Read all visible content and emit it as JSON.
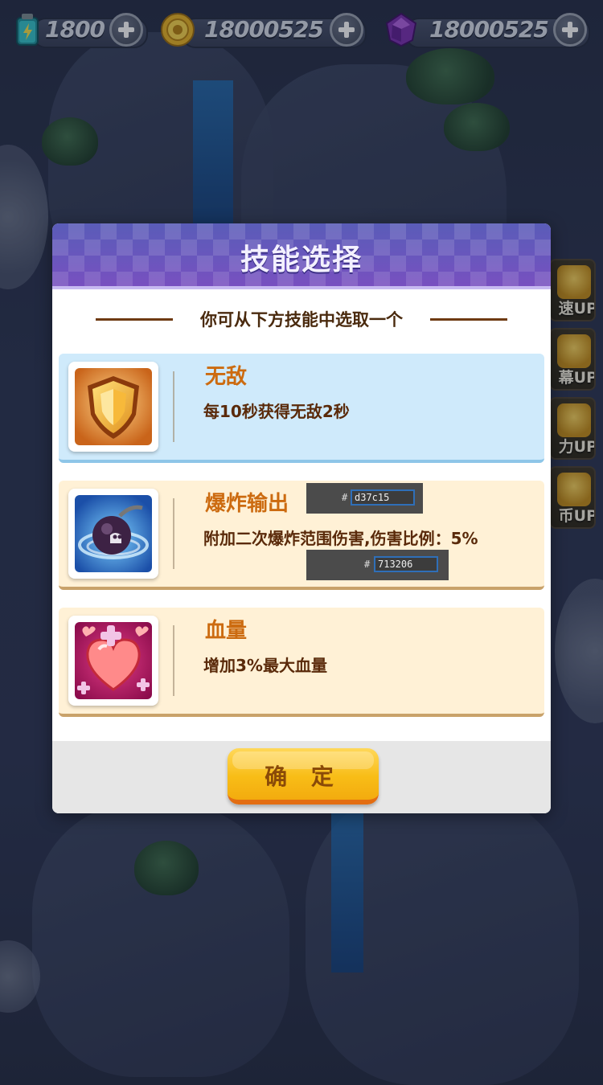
{
  "resources": {
    "energy": {
      "value": "1800",
      "icon": "battery-icon"
    },
    "coins": {
      "value": "18000525",
      "icon": "coin-icon"
    },
    "gems": {
      "value": "18000525",
      "icon": "gem-icon"
    }
  },
  "side_upgrades": [
    {
      "label": "速UP"
    },
    {
      "label": "幕UP"
    },
    {
      "label": "力UP"
    },
    {
      "label": "币UP"
    }
  ],
  "dialog": {
    "title": "技能选择",
    "subtitle": "你可从下方技能中选取一个",
    "skills": [
      {
        "name": "无敌",
        "description": "每10秒获得无敌2秒",
        "icon": "shield-icon"
      },
      {
        "name": "爆炸输出",
        "description": "附加二次爆炸范围伤害,伤害比例：5%",
        "icon": "bomb-icon"
      },
      {
        "name": "血量",
        "description": "增加3%最大血量",
        "icon": "heart-icon"
      }
    ],
    "confirm_label": "确 定"
  },
  "color_tooltips": [
    {
      "hash": "#",
      "value": "d37c15"
    },
    {
      "hash": "#",
      "value": "713206"
    }
  ],
  "colors": {
    "skill_name": "#d37c15",
    "skill_desc": "#713206",
    "header": "#6a56bd",
    "confirm": "#f8bd17"
  }
}
